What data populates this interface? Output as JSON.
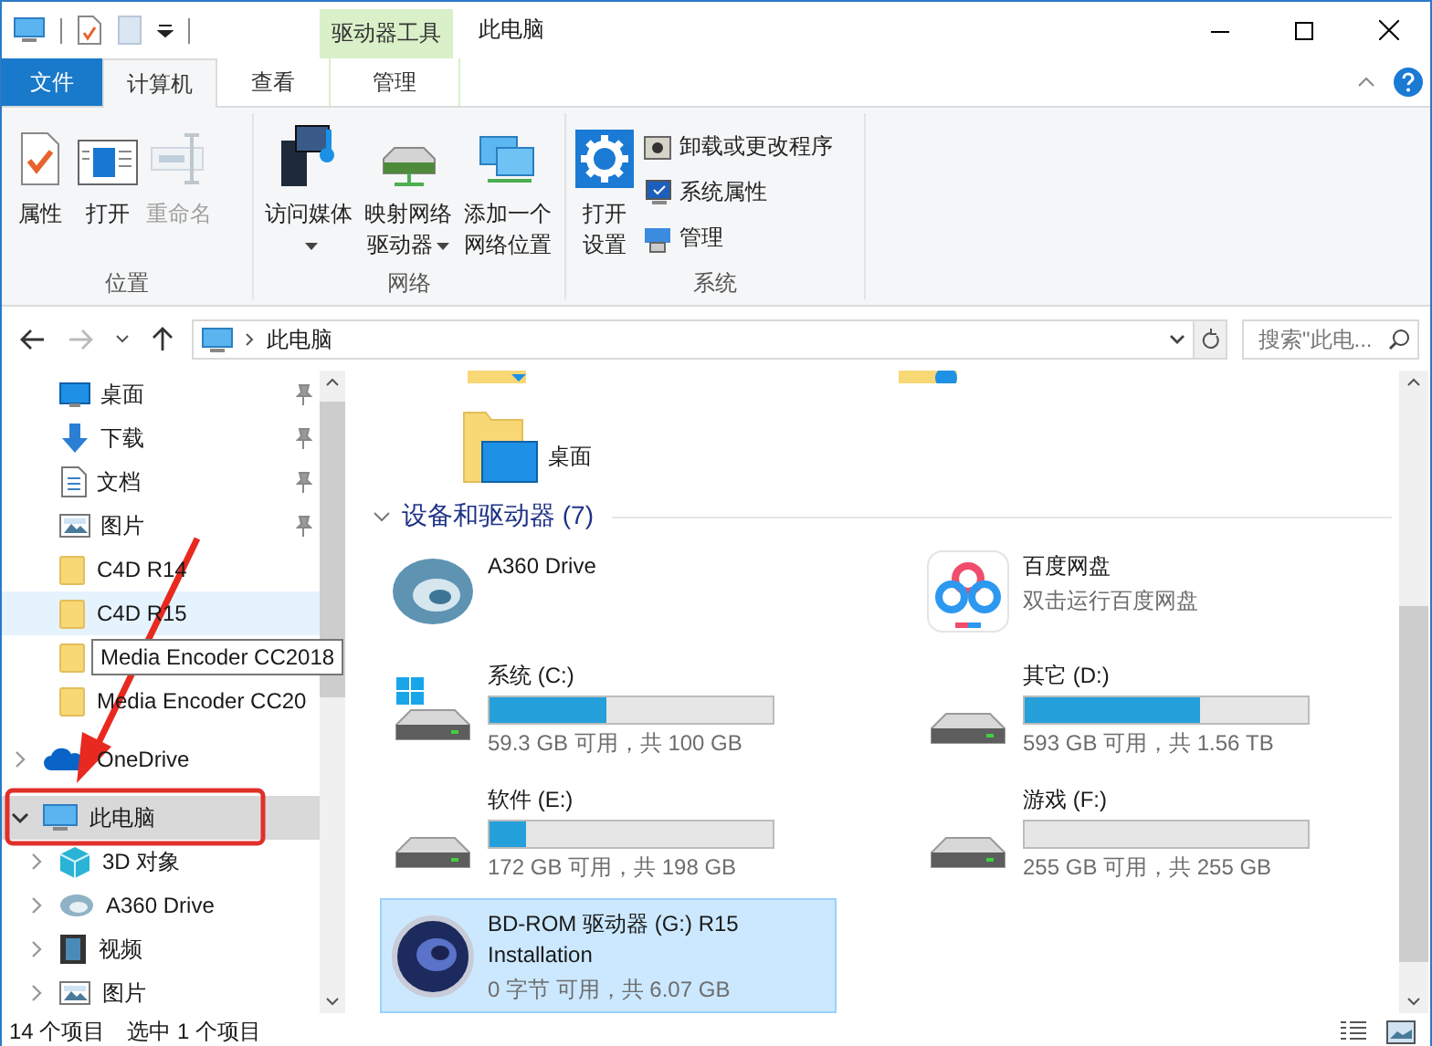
{
  "window": {
    "title": "此电脑",
    "tool_tab_group": "驱动器工具"
  },
  "tabs": [
    {
      "label": "文件",
      "kind": "file",
      "selected": false
    },
    {
      "label": "计算机",
      "kind": "tab",
      "selected": true
    },
    {
      "label": "查看",
      "kind": "tab",
      "selected": false
    },
    {
      "label": "管理",
      "kind": "contextual",
      "selected": false
    }
  ],
  "ribbon": {
    "groups": [
      {
        "label": "位置",
        "buttons": [
          {
            "label": "属性",
            "kind": "large",
            "disabled": false,
            "dropdown": false
          },
          {
            "label": "打开",
            "kind": "large",
            "disabled": false,
            "dropdown": false
          },
          {
            "label": "重命名",
            "kind": "large",
            "disabled": true,
            "dropdown": false
          }
        ]
      },
      {
        "label": "网络",
        "buttons": [
          {
            "label": "访问媒体",
            "kind": "large",
            "disabled": false,
            "dropdown": true
          },
          {
            "label": "映射网络驱动器",
            "kind": "large",
            "disabled": false,
            "dropdown": true
          },
          {
            "label": "添加一个网络位置",
            "kind": "large",
            "disabled": false,
            "dropdown": false
          }
        ]
      },
      {
        "label": "系统",
        "buttons": [
          {
            "label": "打开设置",
            "kind": "large",
            "disabled": false,
            "dropdown": false
          },
          {
            "label": "卸载或更改程序",
            "kind": "small",
            "disabled": false,
            "dropdown": false
          },
          {
            "label": "系统属性",
            "kind": "small",
            "disabled": false,
            "dropdown": false
          },
          {
            "label": "管理",
            "kind": "small",
            "disabled": false,
            "dropdown": false
          }
        ]
      }
    ]
  },
  "address_bar": {
    "path": "此电脑",
    "search_placeholder": "搜索\"此电..."
  },
  "nav_pane": {
    "quick_access": [
      {
        "label": "桌面",
        "kind": "desktop",
        "pinned": true,
        "highlighted": false,
        "tooltip": false
      },
      {
        "label": "下载",
        "kind": "downloads",
        "pinned": true,
        "highlighted": false,
        "tooltip": false
      },
      {
        "label": "文档",
        "kind": "documents",
        "pinned": true,
        "highlighted": false,
        "tooltip": false
      },
      {
        "label": "图片",
        "kind": "pictures",
        "pinned": true,
        "highlighted": false,
        "tooltip": false
      },
      {
        "label": "C4D R14",
        "kind": "folder",
        "pinned": false,
        "highlighted": false,
        "tooltip": false
      },
      {
        "label": "C4D R15",
        "kind": "folder",
        "pinned": false,
        "highlighted": true,
        "tooltip": false
      },
      {
        "label": "Media Encoder CC2018",
        "kind": "folder",
        "pinned": false,
        "highlighted": false,
        "tooltip": true
      },
      {
        "label": "Media Encoder CC20",
        "kind": "folder",
        "pinned": false,
        "highlighted": false,
        "tooltip": false
      }
    ],
    "tree": [
      {
        "label": "OneDrive",
        "kind": "onedrive",
        "expanded": false,
        "selected": false
      },
      {
        "label": "此电脑",
        "kind": "computer",
        "expanded": true,
        "selected": true,
        "children": [
          {
            "label": "3D 对象",
            "kind": "objects3d",
            "expanded": false,
            "selected": false
          },
          {
            "label": "A360 Drive",
            "kind": "cloud-service",
            "expanded": false,
            "selected": false
          },
          {
            "label": "视频",
            "kind": "videos",
            "expanded": false,
            "selected": false
          },
          {
            "label": "图片",
            "kind": "pictures",
            "expanded": false,
            "selected": false
          }
        ]
      }
    ]
  },
  "content": {
    "folders": [
      {
        "label": "桌面",
        "kind": "desktop"
      }
    ],
    "devices_section": {
      "title": "设备和驱动器 (7)",
      "expanded": true,
      "items": [
        {
          "name": "A360 Drive",
          "kind": "cloud-service",
          "selected": false
        },
        {
          "name": "百度网盘",
          "kind": "app",
          "subtitle": "双击运行百度网盘",
          "selected": false
        },
        {
          "name": "系统 (C:)",
          "kind": "system-drive",
          "level": 0.41,
          "reading": "59.3 GB 可用，共 100 GB",
          "selected": false
        },
        {
          "name": "其它 (D:)",
          "kind": "drive",
          "level": 0.62,
          "reading": "593 GB 可用，共 1.56 TB",
          "selected": false
        },
        {
          "name": "软件 (E:)",
          "kind": "drive",
          "level": 0.13,
          "reading": "172 GB 可用，共 198 GB",
          "selected": false
        },
        {
          "name": "游戏 (F:)",
          "kind": "drive",
          "level": 0,
          "reading": "255 GB 可用，共 255 GB",
          "selected": false
        },
        {
          "name": "BD-ROM 驱动器 (G:) R15\nInstallation",
          "kind": "disc",
          "reading": "0 字节 可用，共 6.07 GB",
          "selected": true
        }
      ]
    }
  },
  "status_bar": {
    "item_count": "14 个项目",
    "selection": "选中 1 个项目"
  }
}
